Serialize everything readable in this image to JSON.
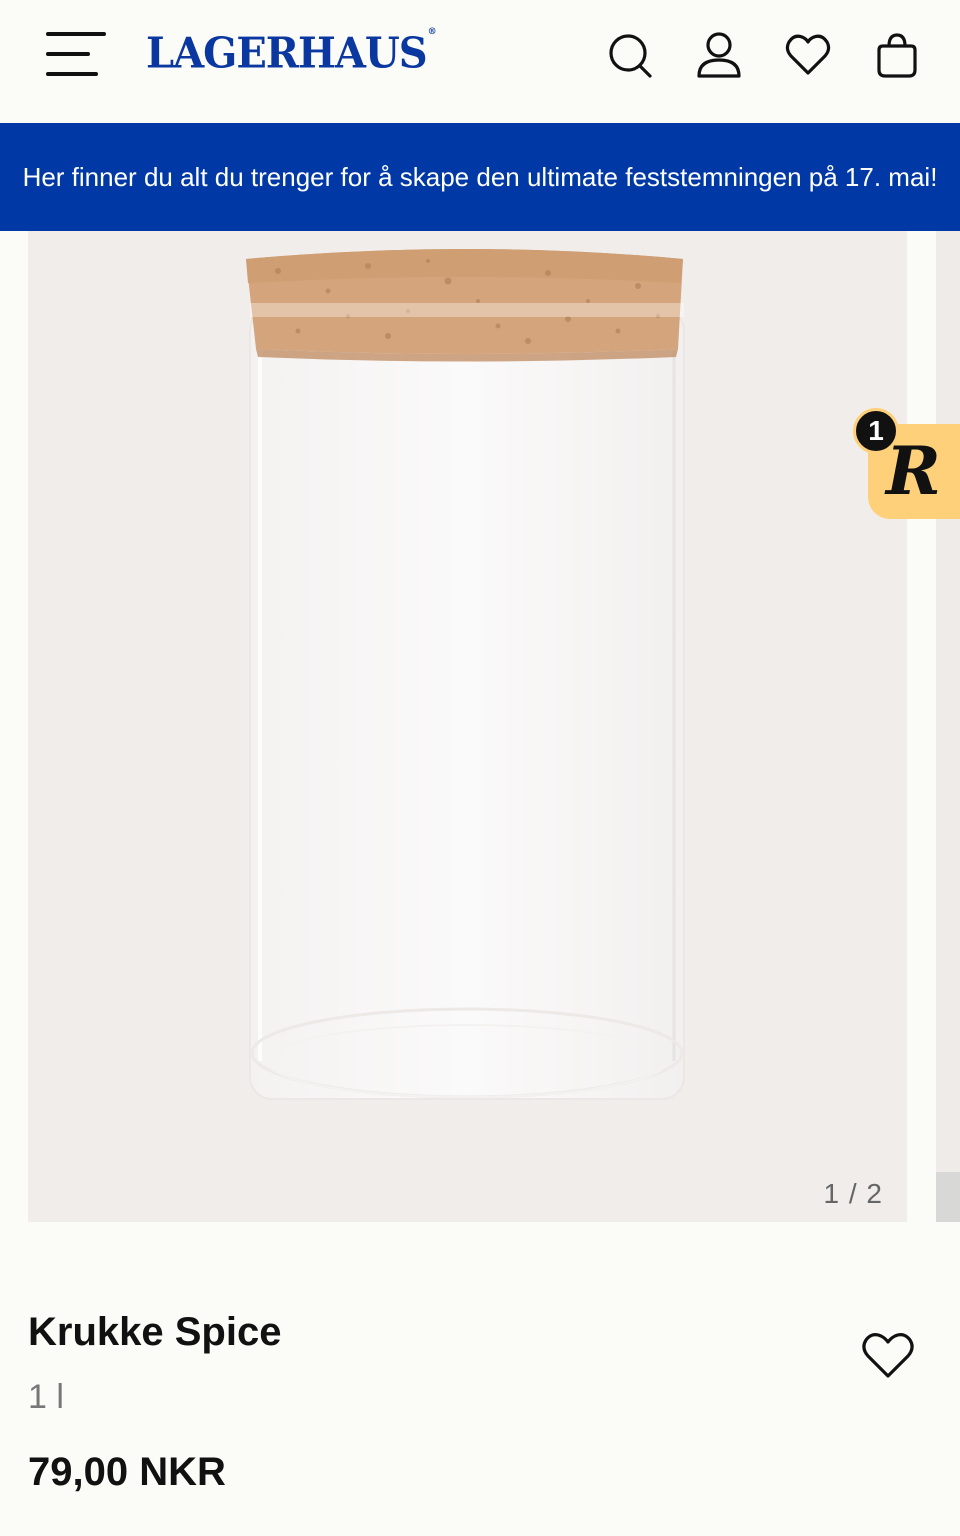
{
  "header": {
    "logo": "LAGERHAUS",
    "logo_mark": "®",
    "icons": [
      "menu-icon",
      "search-icon",
      "account-icon",
      "heart-icon",
      "bag-icon"
    ]
  },
  "banner": {
    "text": "Her finner du alt du trenger for å skape den ultimate feststemningen på 17. mai!"
  },
  "gallery": {
    "counter": "1 / 2"
  },
  "widget": {
    "letter": "R",
    "count": "1"
  },
  "product": {
    "title": "Krukke Spice",
    "variant": "1 l",
    "price": "79,00 NKR"
  },
  "colors": {
    "brand": "#0a38a0",
    "banner_bg": "#0039a6",
    "widget_bg": "#ffd07a",
    "gallery_bg": "#f1edeb"
  }
}
